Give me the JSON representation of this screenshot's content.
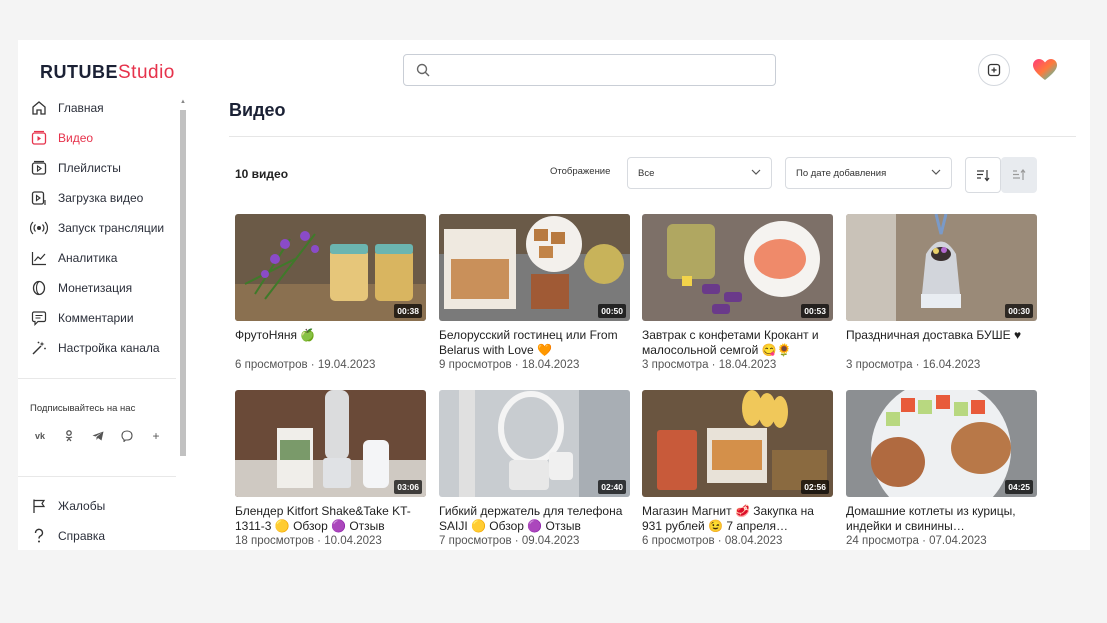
{
  "brand": {
    "part1": "RUTUBE",
    "part2": "Studio",
    "accent": "#e6324b",
    "dark": "#1b2135"
  },
  "header": {
    "search_placeholder": "",
    "search_icon": "search-icon",
    "upload_icon": "upload-icon",
    "avatar_icon": "heart-avatar-icon"
  },
  "sidebar": {
    "items": [
      {
        "label": "Главная",
        "icon": "home-icon"
      },
      {
        "label": "Видео",
        "icon": "video-icon",
        "active": true
      },
      {
        "label": "Плейлисты",
        "icon": "playlist-icon"
      },
      {
        "label": "Загрузка видео",
        "icon": "upload-video-icon"
      },
      {
        "label": "Запуск трансляции",
        "icon": "broadcast-icon"
      },
      {
        "label": "Аналитика",
        "icon": "analytics-icon"
      },
      {
        "label": "Монетизация",
        "icon": "monetization-icon"
      },
      {
        "label": "Комментарии",
        "icon": "comments-icon"
      },
      {
        "label": "Настройка канала",
        "icon": "settings-wand-icon"
      }
    ],
    "subscribe_label": "Подписывайтесь на нас",
    "social": [
      "vk-icon",
      "ok-icon",
      "telegram-icon",
      "viber-icon",
      "plus-icon"
    ],
    "bottom_items": [
      {
        "label": "Жалобы",
        "icon": "flag-icon"
      },
      {
        "label": "Справка",
        "icon": "help-icon"
      }
    ]
  },
  "main": {
    "title": "Видео",
    "count": "10 видео",
    "display_label": "Отображение",
    "display_value": "Все",
    "sort_value": "По дате добавления"
  },
  "videos": [
    {
      "title": "ФрутоНяня 🍏",
      "views": "6 просмотров",
      "date": "19.04.2023",
      "duration": "00:38"
    },
    {
      "title": "Белорусский гостинец или From Belarus with Love 🧡",
      "views": "9 просмотров",
      "date": "18.04.2023",
      "duration": "00:50"
    },
    {
      "title": "Завтрак с конфетами Крокант и малосольной семгой 😋🌻",
      "views": "3 просмотра",
      "date": "18.04.2023",
      "duration": "00:53"
    },
    {
      "title": "Праздничная доставка БУШЕ ♥",
      "views": "3 просмотра",
      "date": "16.04.2023",
      "duration": "00:30"
    },
    {
      "title": "Блендер Kitfort Shake&Take KT-1311-3 🟡 Обзор 🟣 Отзыв",
      "views": "18 просмотров",
      "date": "10.04.2023",
      "duration": "03:06"
    },
    {
      "title": "Гибкий держатель для телефона SAIJI 🟡 Обзор 🟣 Отзыв",
      "views": "7 просмотров",
      "date": "09.04.2023",
      "duration": "02:40"
    },
    {
      "title": "Магазин Магнит 🥩 Закупка на 931 рублей 😉 7 апреля…",
      "views": "6 просмотров",
      "date": "08.04.2023",
      "duration": "02:56"
    },
    {
      "title": "Домашние котлеты из курицы, индейки и свинины…",
      "views": "24 просмотра",
      "date": "07.04.2023",
      "duration": "04:25"
    }
  ]
}
